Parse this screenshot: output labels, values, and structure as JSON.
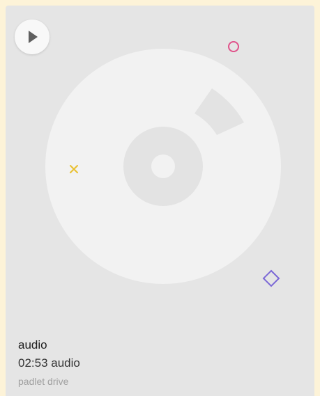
{
  "card": {
    "title": "audio",
    "subtitle": "02:53 audio",
    "source": "padlet drive"
  },
  "player": {
    "play_icon": "play-icon"
  },
  "artwork": {
    "disc_icon": "vinyl-disc-icon",
    "decorations": [
      "circle-shape",
      "cross-shape",
      "diamond-shape"
    ],
    "colors": {
      "background": "#e5e5e5",
      "disc": "#f2f2f2",
      "label": "#e3e3e3",
      "circle": "#e0528a",
      "cross": "#e8c030",
      "diamond": "#7b68d6"
    }
  }
}
